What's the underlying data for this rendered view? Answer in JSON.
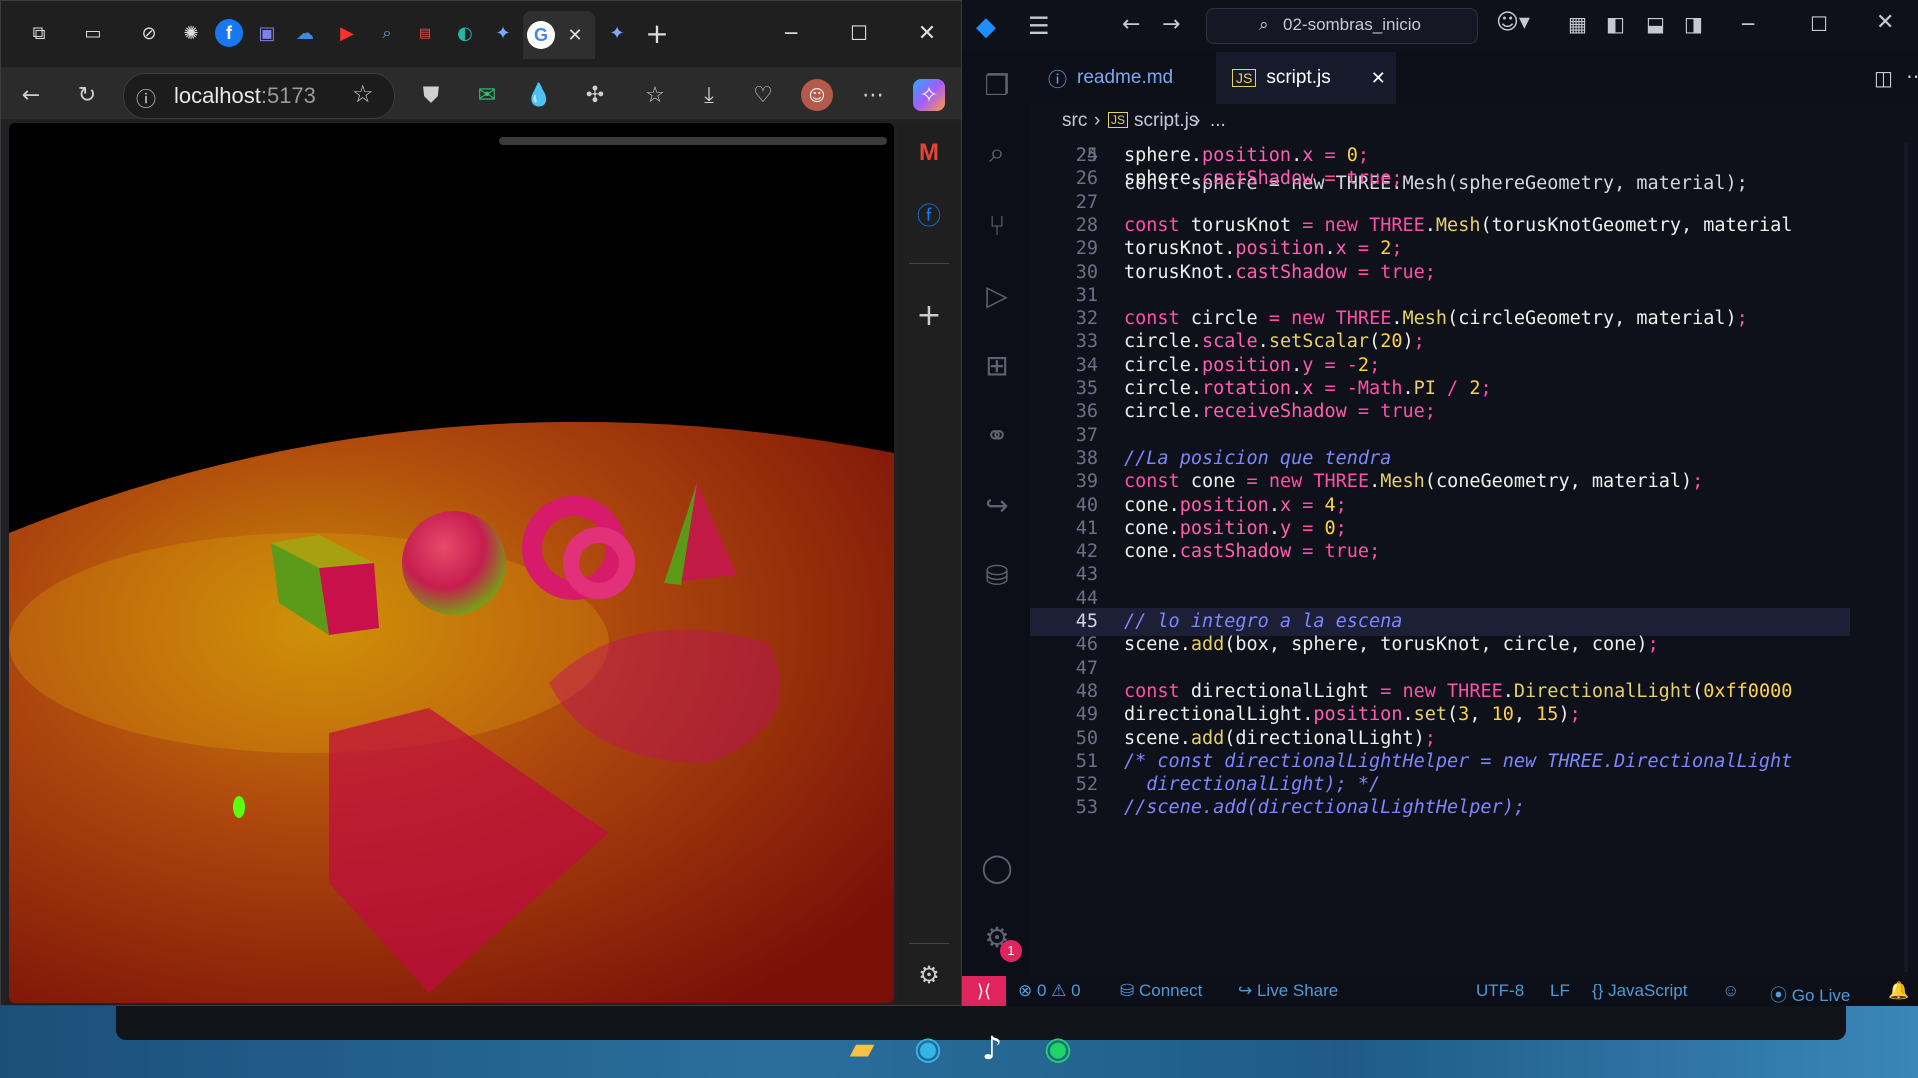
{
  "browser": {
    "url_host": "localhost",
    "url_port": ":5173",
    "tabs_icons": [
      "workspaces-icon",
      "tab-actions-icon",
      "blocked-tab-icon",
      "chatgpt-icon",
      "facebook-icon",
      "teams-icon",
      "onedrive-icon",
      "youtube-icon",
      "search-icon",
      "pdf-icon",
      "copilot-tab-icon",
      "gemini-icon",
      "google-icon",
      "close-icon",
      "gemini-icon",
      "new-tab-icon"
    ],
    "window_controls": [
      "minimize",
      "maximize",
      "close"
    ]
  },
  "vscode": {
    "search_placeholder": "02-sombras_inicio",
    "tabs": [
      {
        "label": "readme.md",
        "active": false
      },
      {
        "label": "script.js",
        "active": true
      }
    ],
    "breadcrumb": {
      "folder": "src",
      "file": "script.js",
      "more": "..."
    },
    "partial_top_line": "const sphere = new THREE.Mesh(sphereGeometry, material);",
    "lines": [
      {
        "n": "25",
        "t": "sphere.position.x = 0;"
      },
      {
        "n": "26",
        "t": "sphere.castShadow = true;"
      },
      {
        "n": "27",
        "t": ""
      },
      {
        "n": "28",
        "t": "const torusKnot = new THREE.Mesh(torusKnotGeometry, material"
      },
      {
        "n": "29",
        "t": "torusKnot.position.x = 2;"
      },
      {
        "n": "30",
        "t": "torusKnot.castShadow = true;"
      },
      {
        "n": "31",
        "t": ""
      },
      {
        "n": "32",
        "t": "const circle = new THREE.Mesh(circleGeometry, material);"
      },
      {
        "n": "33",
        "t": "circle.scale.setScalar(20);"
      },
      {
        "n": "34",
        "t": "circle.position.y = -2;"
      },
      {
        "n": "35",
        "t": "circle.rotation.x = -Math.PI / 2;"
      },
      {
        "n": "36",
        "t": "circle.receiveShadow = true;"
      },
      {
        "n": "37",
        "t": ""
      },
      {
        "n": "38",
        "t": "//La posicion que tendra"
      },
      {
        "n": "39",
        "t": "const cone = new THREE.Mesh(coneGeometry, material);"
      },
      {
        "n": "40",
        "t": "cone.position.x = 4;"
      },
      {
        "n": "41",
        "t": "cone.position.y = 0;"
      },
      {
        "n": "42",
        "t": "cone.castShadow = true;"
      },
      {
        "n": "43",
        "t": ""
      },
      {
        "n": "44",
        "t": ""
      },
      {
        "n": "45",
        "t": "// lo integro a la escena"
      },
      {
        "n": "46",
        "t": "scene.add(box, sphere, torusKnot, circle, cone);"
      },
      {
        "n": "47",
        "t": ""
      },
      {
        "n": "48",
        "t": "const directionalLight = new THREE.DirectionalLight(0xff0000"
      },
      {
        "n": "49",
        "t": "directionalLight.position.set(3, 10, 15);"
      },
      {
        "n": "50",
        "t": "scene.add(directionalLight);"
      },
      {
        "n": "51",
        "t": "/* const directionalLightHelper = new THREE.DirectionalLight"
      },
      {
        "n": "52",
        "t": "  directionalLight); */"
      },
      {
        "n": "53",
        "t": "//scene.add(directionalLightHelper);"
      }
    ],
    "active_line": "45",
    "settings_badge": "1",
    "status": {
      "errors": "0",
      "warnings": "0",
      "connect": "Connect",
      "live_share": "Live Share",
      "encoding": "UTF-8",
      "eol": "LF",
      "language": "JavaScript",
      "go_live": "Go Live"
    }
  },
  "colors": {
    "accent_pink": "#ff4fa8",
    "editor_bg": "#0f111a",
    "remote_button": "#e0245e"
  }
}
